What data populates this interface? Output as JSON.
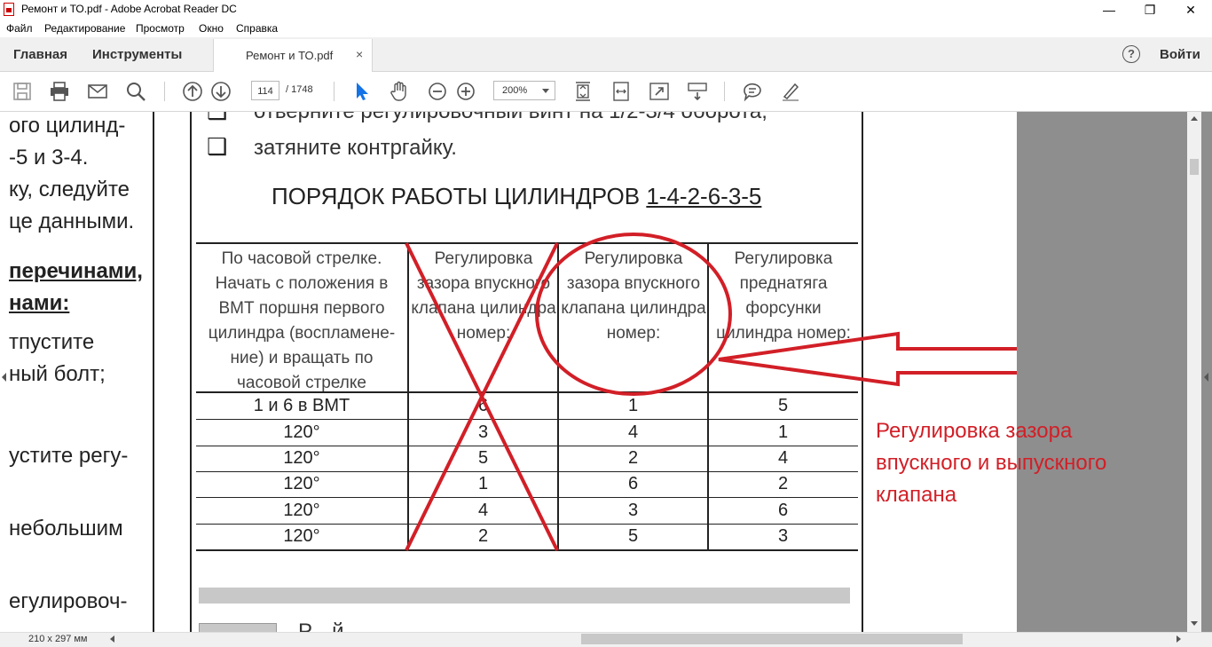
{
  "window": {
    "title": "Ремонт и ТО.pdf - Adobe Acrobat Reader DC",
    "minimize": "—",
    "maximize": "❐",
    "close": "✕"
  },
  "menu": [
    "Файл",
    "Редактирование",
    "Просмотр",
    "Окно",
    "Справка"
  ],
  "tabs": {
    "home": "Главная",
    "tools": "Инструменты",
    "document": "Ремонт и ТО.pdf",
    "close": "×",
    "help": "?",
    "signin": "Войти"
  },
  "toolbar": {
    "page_current": "114",
    "page_total": "/ 1748",
    "zoom": "200%"
  },
  "left_page": {
    "lines": [
      "ого цилинд-",
      "-5 и 3-4.",
      "ку, следуйте",
      "це данными.",
      "перечинами,",
      "нами:",
      "тпустите",
      "ный болт;",
      "устите регу-",
      "небольшим",
      "егулировоч-"
    ]
  },
  "document": {
    "steps": [
      "отверните регулировочный винт на 1/2-3/4 оборота;",
      "затяните контргайку."
    ],
    "table_title_prefix": "ПОРЯДОК РАБОТЫ ЦИЛИНДРОВ ",
    "table_title_order": "1-4-2-6-3-5",
    "headers": [
      "По часовой стрелке. Начать с положения в ВМТ поршня первого цилиндра (воспламене-ние) и вращать по часовой стрелке",
      "Регулировка зазора впускного клапана цилиндра номер:",
      "Регулировка зазора впускного клапана цилиндра номер:",
      "Регулировка преднатяга форсунки цилиндра номер:"
    ],
    "rows": [
      [
        "1 и 6 в ВМТ",
        "6",
        "1",
        "5"
      ],
      [
        "120°",
        "3",
        "4",
        "1"
      ],
      [
        "120°",
        "5",
        "2",
        "4"
      ],
      [
        "120°",
        "1",
        "6",
        "2"
      ],
      [
        "120°",
        "4",
        "3",
        "6"
      ],
      [
        "120°",
        "2",
        "5",
        "3"
      ]
    ],
    "below_text": "Р... й"
  },
  "annotation": {
    "lines": [
      "Регулировка зазора",
      "впускного и выпускного",
      "клапана"
    ],
    "color": "#d21f27"
  },
  "status": {
    "page_size": "210 x 297 мм"
  },
  "colors": {
    "annotation": "#d21f27",
    "accent": "#1473e6"
  }
}
